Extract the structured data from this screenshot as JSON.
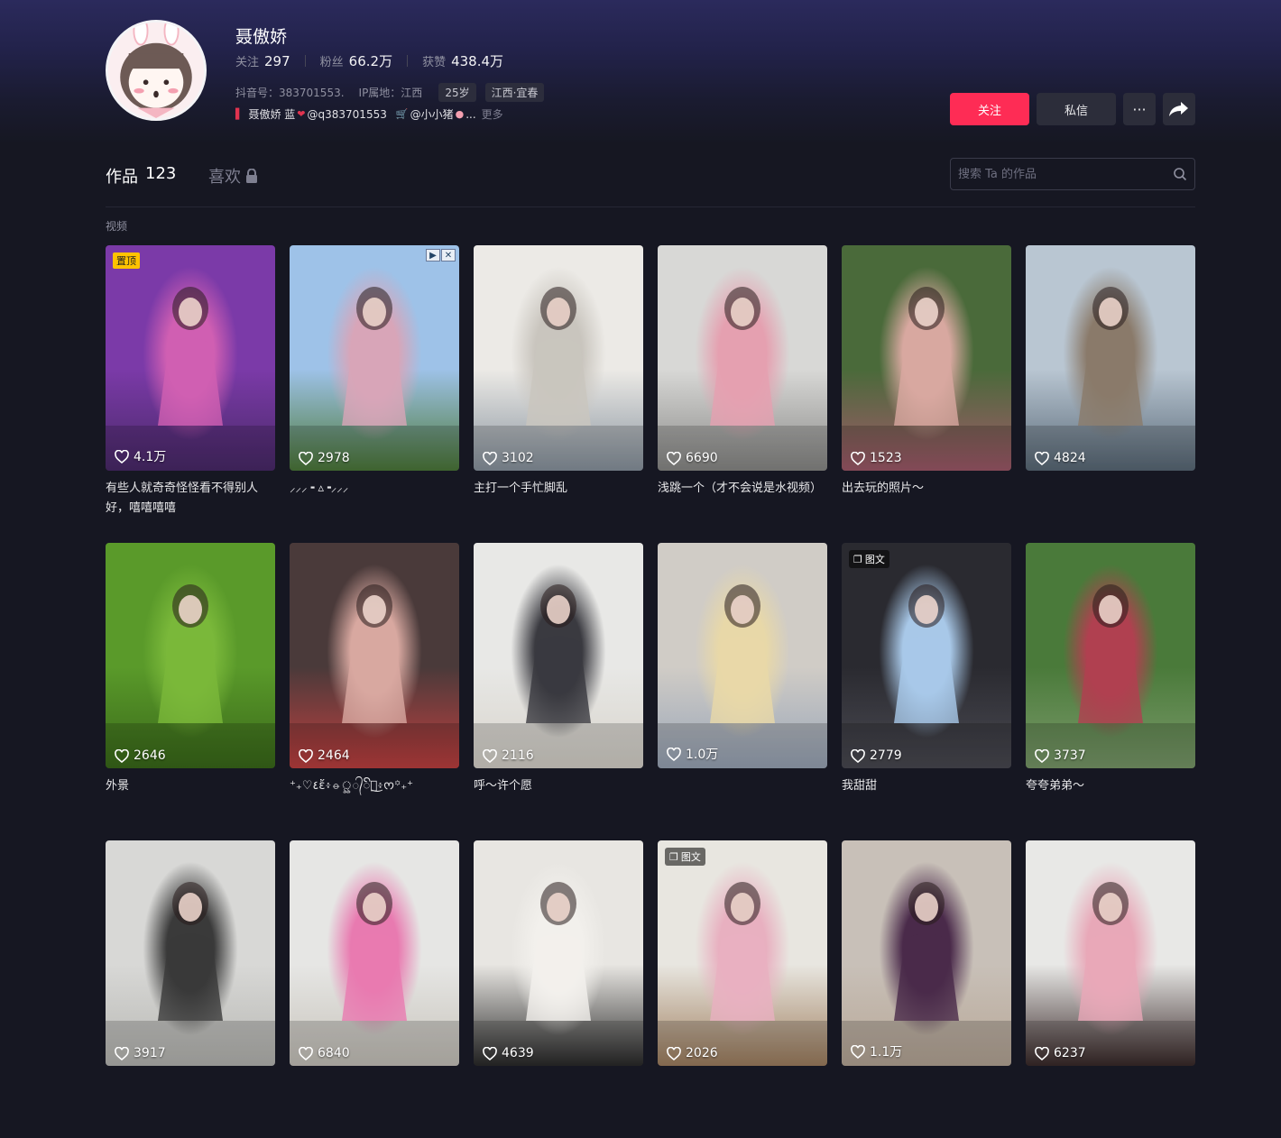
{
  "profile": {
    "name": "聂傲娇",
    "following_label": "关注",
    "following": "297",
    "fans_label": "粉丝",
    "fans": "66.2万",
    "likes_label": "获赞",
    "likes": "438.4万",
    "douyin_id": "抖音号：383701553.",
    "ip": "IP属地：江西",
    "age": "25岁",
    "location": "江西·宜春",
    "bio_part1": "聂傲娇 蓝",
    "bio_part2": "@q383701553",
    "bio_part3": "@小小猪",
    "bio_ellipsis": "...",
    "bio_more": "更多"
  },
  "actions": {
    "follow": "关注",
    "message": "私信",
    "more": "···"
  },
  "tabs": {
    "works_label": "作品",
    "works_count": "123",
    "likes_label": "喜欢"
  },
  "search": {
    "placeholder": "搜索 Ta 的作品"
  },
  "section": {
    "label": "视频"
  },
  "badges": {
    "pinned": "置顶",
    "image_post": "图文"
  },
  "videos": [
    {
      "likes": "4.1万",
      "caption": "有些人就奇奇怪怪看不得别人好，嘻嘻嘻嘻",
      "pinned": true,
      "colors": [
        "#7b3aa8",
        "#d05fb2",
        "#4a2a6a"
      ]
    },
    {
      "likes": "2978",
      "caption": "⸝⸝⸝ ╸▵╺⸝⸝⸝",
      "ad": true,
      "colors": [
        "#9ec2e8",
        "#d8a5b8",
        "#4d7a3a"
      ]
    },
    {
      "likes": "3102",
      "caption": "主打一个手忙脚乱",
      "colors": [
        "#eceae6",
        "#c9c5be",
        "#8a95a0"
      ]
    },
    {
      "likes": "6690",
      "caption": "浅跳一个（才不会说是水视频）",
      "colors": [
        "#d8d8d6",
        "#e5a0b0",
        "#8a8a88"
      ]
    },
    {
      "likes": "1523",
      "caption": "出去玩的照片～",
      "colors": [
        "#4a6a3a",
        "#d8a8a0",
        "#a05a6a"
      ]
    },
    {
      "likes": "4824",
      "caption": "",
      "colors": [
        "#b9c6d2",
        "#8a7a6a",
        "#5a6a78"
      ]
    },
    {
      "likes": "2646",
      "caption": "外景",
      "colors": [
        "#5a9a2a",
        "#7ab83a",
        "#3a6a1a"
      ]
    },
    {
      "likes": "2464",
      "caption": "⁺₊♡٤ἔ፥⦵ৣ᭄ꦼ᭄͜፥ᰔ꙳₊⁺",
      "colors": [
        "#4a3a3a",
        "#d8a8a0",
        "#c04040"
      ]
    },
    {
      "likes": "2116",
      "caption": "呼～许个愿",
      "colors": [
        "#e8e8e6",
        "#3a3a40",
        "#d8d4cc"
      ]
    },
    {
      "likes": "1.0万",
      "caption": "",
      "colors": [
        "#d0ccc6",
        "#e8d8a8",
        "#9aa6b8"
      ]
    },
    {
      "likes": "2779",
      "caption": "我甜甜",
      "image_post": true,
      "colors": [
        "#2a2a30",
        "#a8c8e8",
        "#4a4a52"
      ]
    },
    {
      "likes": "3737",
      "caption": "夸夸弟弟～",
      "colors": [
        "#4a7a3a",
        "#b04050",
        "#7a9a6a"
      ]
    },
    {
      "likes": "3917",
      "caption": "",
      "colors": [
        "#d8d8d6",
        "#3a3a3a",
        "#b8b8b4"
      ]
    },
    {
      "likes": "6840",
      "caption": "",
      "colors": [
        "#e6e6e4",
        "#e87ab0",
        "#c8c4bc"
      ]
    },
    {
      "likes": "4639",
      "caption": "",
      "colors": [
        "#e8e6e2",
        "#f2f0ec",
        "#2a2a2a"
      ]
    },
    {
      "likes": "2026",
      "caption": "",
      "image_post": true,
      "colors": [
        "#e8e6e0",
        "#e8b0c0",
        "#a08060"
      ]
    },
    {
      "likes": "1.1万",
      "caption": "",
      "colors": [
        "#c8c0b8",
        "#4a2a4a",
        "#b8a898"
      ]
    },
    {
      "likes": "6237",
      "caption": "",
      "colors": [
        "#e8e8e6",
        "#e8a8b8",
        "#3a2a2a"
      ]
    }
  ]
}
